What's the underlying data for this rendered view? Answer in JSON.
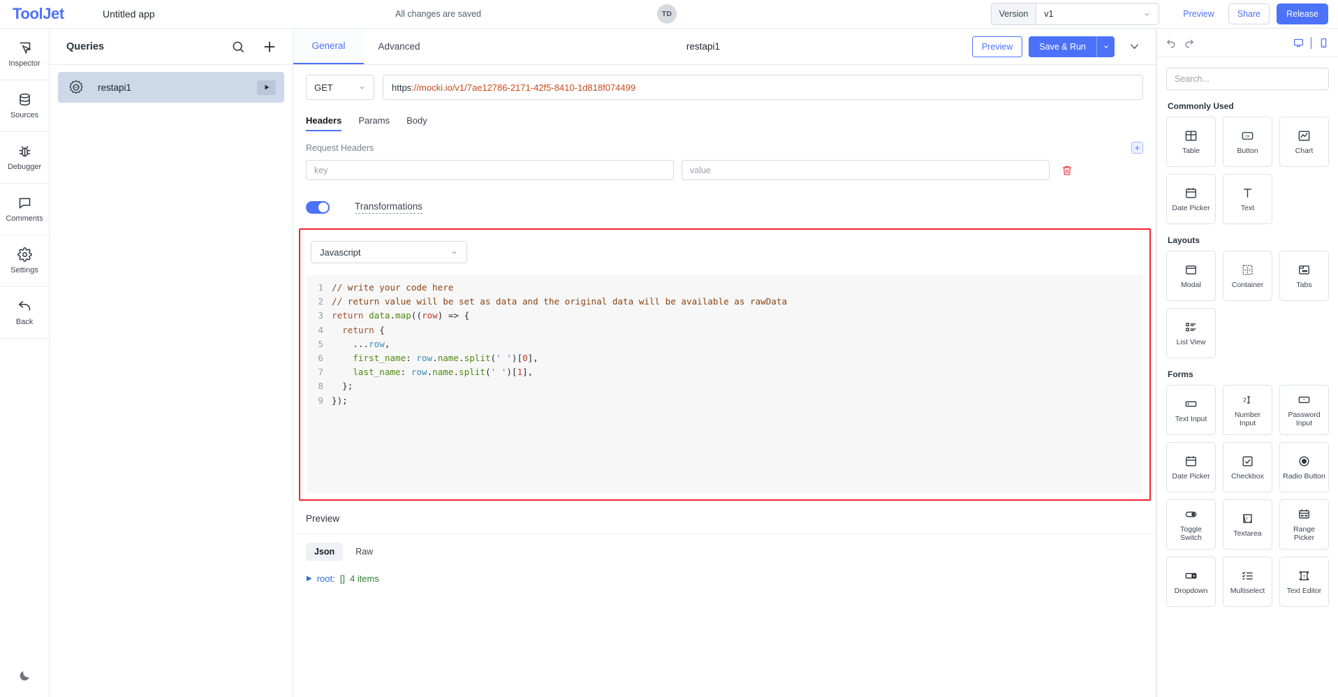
{
  "topbar": {
    "logo": "ToolJet",
    "app_title": "Untitled app",
    "save_status": "All changes are saved",
    "avatar_initials": "TD",
    "version_label": "Version",
    "version_value": "v1",
    "preview_label": "Preview",
    "share_label": "Share",
    "release_label": "Release",
    "accent_color": "#4d72fa"
  },
  "rail": {
    "items": [
      {
        "label": "Inspector",
        "icon": "inspector-icon"
      },
      {
        "label": "Sources",
        "icon": "database-icon"
      },
      {
        "label": "Debugger",
        "icon": "bug-icon"
      },
      {
        "label": "Comments",
        "icon": "comment-icon"
      },
      {
        "label": "Settings",
        "icon": "gear-icon"
      },
      {
        "label": "Back",
        "icon": "back-arrow-icon"
      }
    ],
    "darkmode_icon": "moon-icon"
  },
  "queries": {
    "title": "Queries",
    "search_icon": "search-icon",
    "add_icon": "plus-icon",
    "items": [
      {
        "name": "restapi1",
        "icon": "api-gear-icon",
        "run_icon": "play-icon",
        "selected": true
      }
    ]
  },
  "main": {
    "tabs": [
      {
        "label": "General",
        "active": true
      },
      {
        "label": "Advanced",
        "active": false
      }
    ],
    "query_name": "restapi1",
    "preview_label": "Preview",
    "save_run_label": "Save & Run",
    "request": {
      "method": "GET",
      "url_protocol": "https",
      "url_rest": "://mocki.io/v1/7ae12786-2171-42f5-8410-1d818f074499",
      "url_full": "https://mocki.io/v1/7ae12786-2171-42f5-8410-1d818f074499",
      "subtabs": [
        {
          "label": "Headers",
          "active": true
        },
        {
          "label": "Params",
          "active": false
        },
        {
          "label": "Body",
          "active": false
        }
      ],
      "headers_section_label": "Request Headers",
      "header_rows": [
        {
          "key_placeholder": "key",
          "key_value": "",
          "value_placeholder": "value",
          "value_value": ""
        }
      ],
      "add_header_label": "+"
    },
    "transformations": {
      "label": "Transformations",
      "enabled": true,
      "language": "Javascript",
      "code_lines": [
        {
          "n": "1",
          "tokens": [
            {
              "t": "// write your code here",
              "c": "tok-comment"
            }
          ]
        },
        {
          "n": "2",
          "tokens": [
            {
              "t": "// return value will be set as data and the original data will be available as rawData",
              "c": "tok-comment"
            }
          ]
        },
        {
          "n": "3",
          "tokens": [
            {
              "t": "return",
              "c": "tok-kw"
            },
            {
              "t": " ",
              "c": "ct"
            },
            {
              "t": "data",
              "c": "tok-fn"
            },
            {
              "t": ".",
              "c": "tok-punc"
            },
            {
              "t": "map",
              "c": "tok-fn"
            },
            {
              "t": "((",
              "c": "tok-punc"
            },
            {
              "t": "row",
              "c": "tok-num"
            },
            {
              "t": ") => {",
              "c": "tok-punc"
            }
          ]
        },
        {
          "n": "4",
          "tokens": [
            {
              "t": "  ",
              "c": "ct"
            },
            {
              "t": "return",
              "c": "tok-kw"
            },
            {
              "t": " {",
              "c": "tok-punc"
            }
          ]
        },
        {
          "n": "5",
          "tokens": [
            {
              "t": "    ...",
              "c": "tok-punc"
            },
            {
              "t": "row",
              "c": "tok-var"
            },
            {
              "t": ",",
              "c": "tok-punc"
            }
          ]
        },
        {
          "n": "6",
          "tokens": [
            {
              "t": "    ",
              "c": "ct"
            },
            {
              "t": "first_name",
              "c": "tok-prop"
            },
            {
              "t": ": ",
              "c": "tok-punc"
            },
            {
              "t": "row",
              "c": "tok-var"
            },
            {
              "t": ".",
              "c": "tok-punc"
            },
            {
              "t": "name",
              "c": "tok-fn"
            },
            {
              "t": ".",
              "c": "tok-punc"
            },
            {
              "t": "split",
              "c": "tok-fn"
            },
            {
              "t": "(",
              "c": "tok-punc"
            },
            {
              "t": "' '",
              "c": "tok-str"
            },
            {
              "t": ")[",
              "c": "tok-punc"
            },
            {
              "t": "0",
              "c": "tok-num"
            },
            {
              "t": "],",
              "c": "tok-punc"
            }
          ]
        },
        {
          "n": "7",
          "tokens": [
            {
              "t": "    ",
              "c": "ct"
            },
            {
              "t": "last_name",
              "c": "tok-prop"
            },
            {
              "t": ": ",
              "c": "tok-punc"
            },
            {
              "t": "row",
              "c": "tok-var"
            },
            {
              "t": ".",
              "c": "tok-punc"
            },
            {
              "t": "name",
              "c": "tok-fn"
            },
            {
              "t": ".",
              "c": "tok-punc"
            },
            {
              "t": "split",
              "c": "tok-fn"
            },
            {
              "t": "(",
              "c": "tok-punc"
            },
            {
              "t": "' '",
              "c": "tok-str"
            },
            {
              "t": ")[",
              "c": "tok-punc"
            },
            {
              "t": "1",
              "c": "tok-num"
            },
            {
              "t": "],",
              "c": "tok-punc"
            }
          ]
        },
        {
          "n": "8",
          "tokens": [
            {
              "t": "  };",
              "c": "tok-punc"
            }
          ]
        },
        {
          "n": "9",
          "tokens": [
            {
              "t": "});",
              "c": "tok-punc"
            }
          ]
        }
      ],
      "highlight_color": "#f0232f"
    },
    "preview": {
      "title": "Preview",
      "tabs": [
        {
          "label": "Json",
          "active": true
        },
        {
          "label": "Raw",
          "active": false
        }
      ],
      "root_key": "root:",
      "root_bracket": "[]",
      "root_count": "4 items"
    }
  },
  "rightpanel": {
    "undo_icon": "undo-icon",
    "redo_icon": "redo-icon",
    "desktop_icon": "desktop-icon",
    "mobile_icon": "mobile-icon",
    "search_placeholder": "Search...",
    "groups": [
      {
        "title": "Commonly Used",
        "items": [
          {
            "label": "Table",
            "icon": "table-icon"
          },
          {
            "label": "Button",
            "icon": "button-ok-icon"
          },
          {
            "label": "Chart",
            "icon": "chart-icon"
          },
          {
            "label": "Date Picker",
            "icon": "calendar-icon"
          },
          {
            "label": "Text",
            "icon": "text-t-icon"
          }
        ]
      },
      {
        "title": "Layouts",
        "items": [
          {
            "label": "Modal",
            "icon": "modal-icon"
          },
          {
            "label": "Container",
            "icon": "container-icon"
          },
          {
            "label": "Tabs",
            "icon": "tabs-icon"
          },
          {
            "label": "List View",
            "icon": "list-view-icon"
          }
        ]
      },
      {
        "title": "Forms",
        "items": [
          {
            "label": "Text Input",
            "icon": "text-input-icon"
          },
          {
            "label": "Number Input",
            "icon": "number-input-icon"
          },
          {
            "label": "Password Input",
            "icon": "password-input-icon"
          },
          {
            "label": "Date Picker",
            "icon": "calendar-icon"
          },
          {
            "label": "Checkbox",
            "icon": "checkbox-icon"
          },
          {
            "label": "Radio Button",
            "icon": "radio-icon"
          },
          {
            "label": "Toggle Switch",
            "icon": "toggle-icon"
          },
          {
            "label": "Textarea",
            "icon": "textarea-icon"
          },
          {
            "label": "Range Picker",
            "icon": "range-picker-icon"
          },
          {
            "label": "Dropdown",
            "icon": "dropdown-icon"
          },
          {
            "label": "Multiselect",
            "icon": "multiselect-icon"
          },
          {
            "label": "Text Editor",
            "icon": "text-editor-icon"
          }
        ]
      }
    ]
  }
}
